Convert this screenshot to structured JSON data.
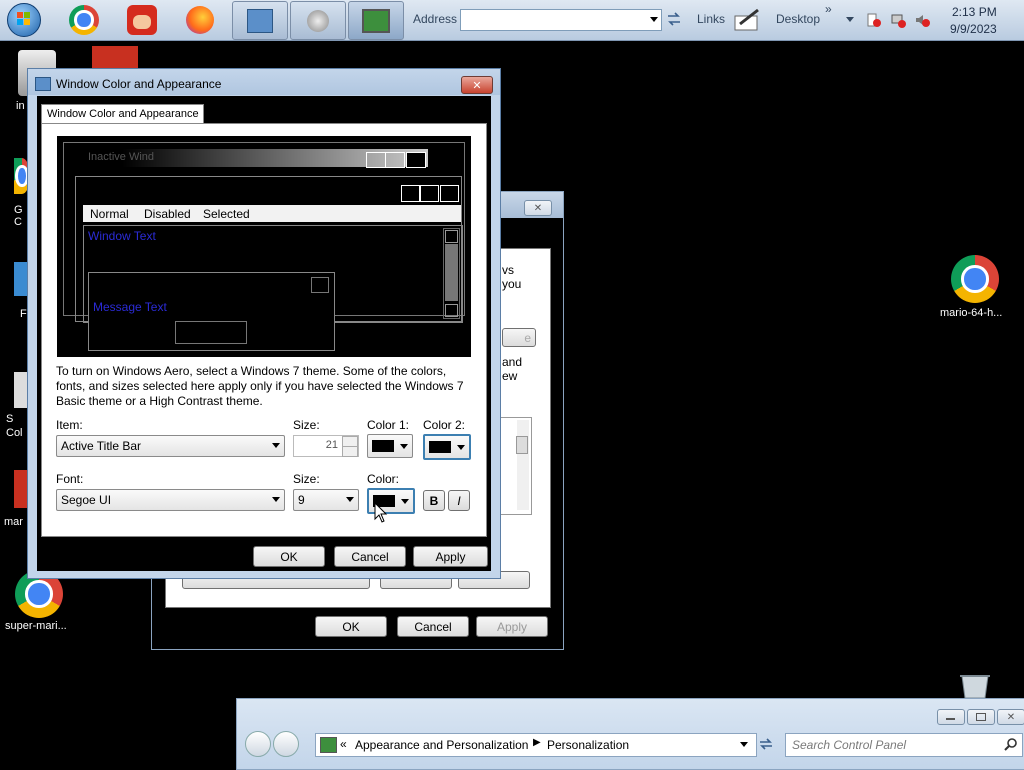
{
  "taskbar": {
    "address_label": "Address",
    "address_value": "",
    "links_label": "Links",
    "desktop_label": "Desktop",
    "time": "2:13 PM",
    "date": "9/9/2023",
    "overflow": "»"
  },
  "desktop": {
    "icons": [
      {
        "label": "in"
      },
      {
        "label": "G C"
      },
      {
        "label": "F"
      },
      {
        "label": "S Col"
      },
      {
        "label": "mar"
      },
      {
        "label": "super-mari..."
      },
      {
        "label": "mario-64-h..."
      }
    ]
  },
  "dialog": {
    "title": "Window Color and Appearance",
    "tab": "Window Color and Appearance",
    "preview": {
      "inactive_title": "Inactive Wind",
      "menu_items": [
        "Normal",
        "Disabled",
        "Selected"
      ],
      "window_text": "Window Text",
      "message_text": "Message Text"
    },
    "description": "To turn on Windows Aero, select a Windows 7 theme.  Some of the colors, fonts, and sizes selected here apply only if you have selected the Windows 7 Basic theme or a High Contrast theme.",
    "item_label": "Item:",
    "item_value": "Active Title Bar",
    "size_label": "Size:",
    "size_value": "21",
    "color1_label": "Color 1:",
    "color2_label": "Color 2:",
    "font_label": "Font:",
    "font_value": "Segoe UI",
    "font_size_label": "Size:",
    "font_size_value": "9",
    "font_color_label": "Color:",
    "bold_label": "B",
    "italic_label": "I",
    "ok": "OK",
    "cancel": "Cancel",
    "apply": "Apply"
  },
  "back_dialog": {
    "partial_text_1": "vs",
    "partial_text_2": "you",
    "partial_text_3": "and",
    "partial_text_4": "ew",
    "partial_btn": "e",
    "ok": "OK",
    "cancel": "Cancel",
    "apply": "Apply"
  },
  "control_panel": {
    "breadcrumb_root": "Appearance and Personalization",
    "breadcrumb_current": "Personalization",
    "search_placeholder": "Search Control Panel"
  },
  "colors": {
    "dialog_bg": "#000000",
    "selected_swatch_border": "#3c7fb1"
  }
}
